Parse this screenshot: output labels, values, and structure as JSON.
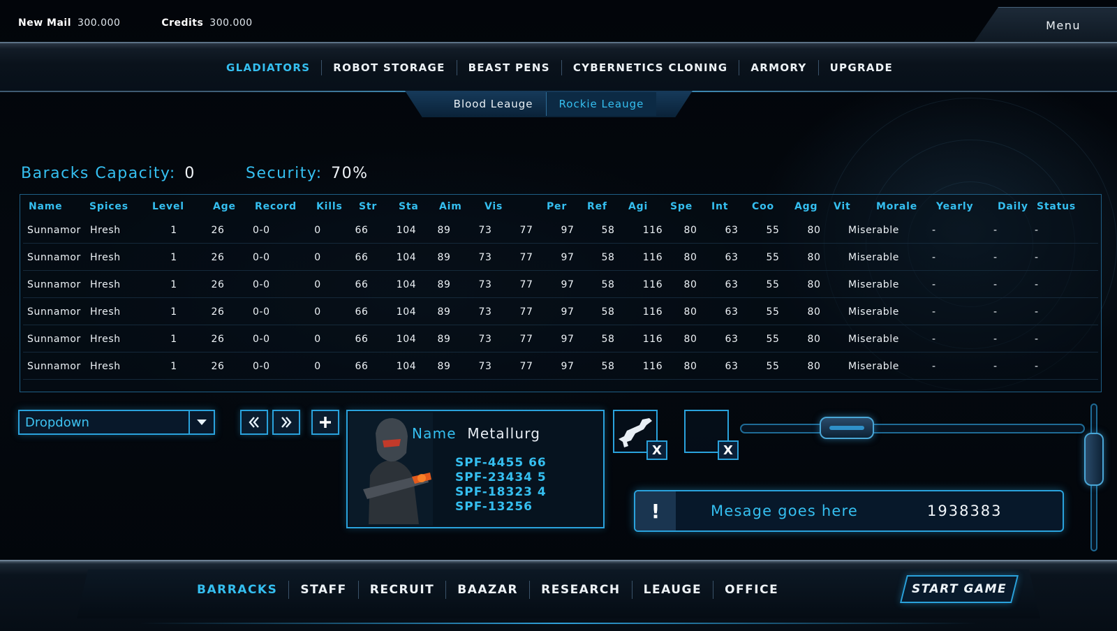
{
  "top": {
    "mail_label": "New Mail",
    "mail_value": "300.000",
    "credits_label": "Credits",
    "credits_value": "300.000",
    "menu_label": "Menu"
  },
  "main_nav": [
    {
      "label": "GLADIATORS",
      "active": true
    },
    {
      "label": "ROBOT STORAGE",
      "active": false
    },
    {
      "label": "BEAST PENS",
      "active": false
    },
    {
      "label": "CYBERNETICS CLONING",
      "active": false
    },
    {
      "label": "ARMORY",
      "active": false
    },
    {
      "label": "UPGRADE",
      "active": false
    }
  ],
  "sub_nav": [
    {
      "label": "Blood Leauge",
      "active": false
    },
    {
      "label": "Rockie Leauge",
      "active": true
    }
  ],
  "barracks": {
    "capacity_label": "Baracks Capacity:",
    "capacity_value": "0",
    "security_label": "Security:",
    "security_value": "70%"
  },
  "table": {
    "headers": [
      "Name",
      "Spices",
      "Level",
      "Age",
      "Record",
      "Kills",
      "Str",
      "Sta",
      "Aim",
      "Vis",
      "Per",
      "Ref",
      "Agi",
      "Spe",
      "Int",
      "Coo",
      "Agg",
      "Vit",
      "Morale",
      "Yearly",
      "Daily",
      "Status"
    ],
    "rows": [
      [
        "Sunnamor",
        "Hresh",
        "1",
        "26",
        "0-0",
        "0",
        "66",
        "104",
        "89",
        "73",
        "77",
        "97",
        "58",
        "116",
        "80",
        "63",
        "55",
        "80",
        "Miserable",
        "-",
        "-",
        "-"
      ],
      [
        "Sunnamor",
        "Hresh",
        "1",
        "26",
        "0-0",
        "0",
        "66",
        "104",
        "89",
        "73",
        "77",
        "97",
        "58",
        "116",
        "80",
        "63",
        "55",
        "80",
        "Miserable",
        "-",
        "-",
        "-"
      ],
      [
        "Sunnamor",
        "Hresh",
        "1",
        "26",
        "0-0",
        "0",
        "66",
        "104",
        "89",
        "73",
        "77",
        "97",
        "58",
        "116",
        "80",
        "63",
        "55",
        "80",
        "Miserable",
        "-",
        "-",
        "-"
      ],
      [
        "Sunnamor",
        "Hresh",
        "1",
        "26",
        "0-0",
        "0",
        "66",
        "104",
        "89",
        "73",
        "77",
        "97",
        "58",
        "116",
        "80",
        "63",
        "55",
        "80",
        "Miserable",
        "-",
        "-",
        "-"
      ],
      [
        "Sunnamor",
        "Hresh",
        "1",
        "26",
        "0-0",
        "0",
        "66",
        "104",
        "89",
        "73",
        "77",
        "97",
        "58",
        "116",
        "80",
        "63",
        "55",
        "80",
        "Miserable",
        "-",
        "-",
        "-"
      ],
      [
        "Sunnamor",
        "Hresh",
        "1",
        "26",
        "0-0",
        "0",
        "66",
        "104",
        "89",
        "73",
        "77",
        "97",
        "58",
        "116",
        "80",
        "63",
        "55",
        "80",
        "Miserable",
        "-",
        "-",
        "-"
      ]
    ]
  },
  "controls": {
    "dropdown_value": "Dropdown",
    "prev_icon": "double-chevron-left-icon",
    "next_icon": "double-chevron-right-icon",
    "add_icon": "plus-icon",
    "slot_close": "X"
  },
  "gladiator_card": {
    "name_label": "Name",
    "name_value": "Metallurg",
    "codes": [
      "SPF-4455 66",
      "SPF-23434 5",
      "SPF-18323 4",
      "SPF-13256"
    ]
  },
  "message": {
    "icon": "!",
    "text": "Mesage goes here",
    "number": "1938383"
  },
  "bottom_nav": [
    {
      "label": "BARRACKS",
      "active": true
    },
    {
      "label": "STAFF",
      "active": false
    },
    {
      "label": "RECRUIT",
      "active": false
    },
    {
      "label": "BAAZAR",
      "active": false
    },
    {
      "label": "RESEARCH",
      "active": false
    },
    {
      "label": "LEAUGE",
      "active": false
    },
    {
      "label": "OFFICE",
      "active": false
    }
  ],
  "start_game_label": "START GAME",
  "colors": {
    "accent": "#35bff0",
    "border": "#2aa2dc",
    "background": "#03070b"
  }
}
